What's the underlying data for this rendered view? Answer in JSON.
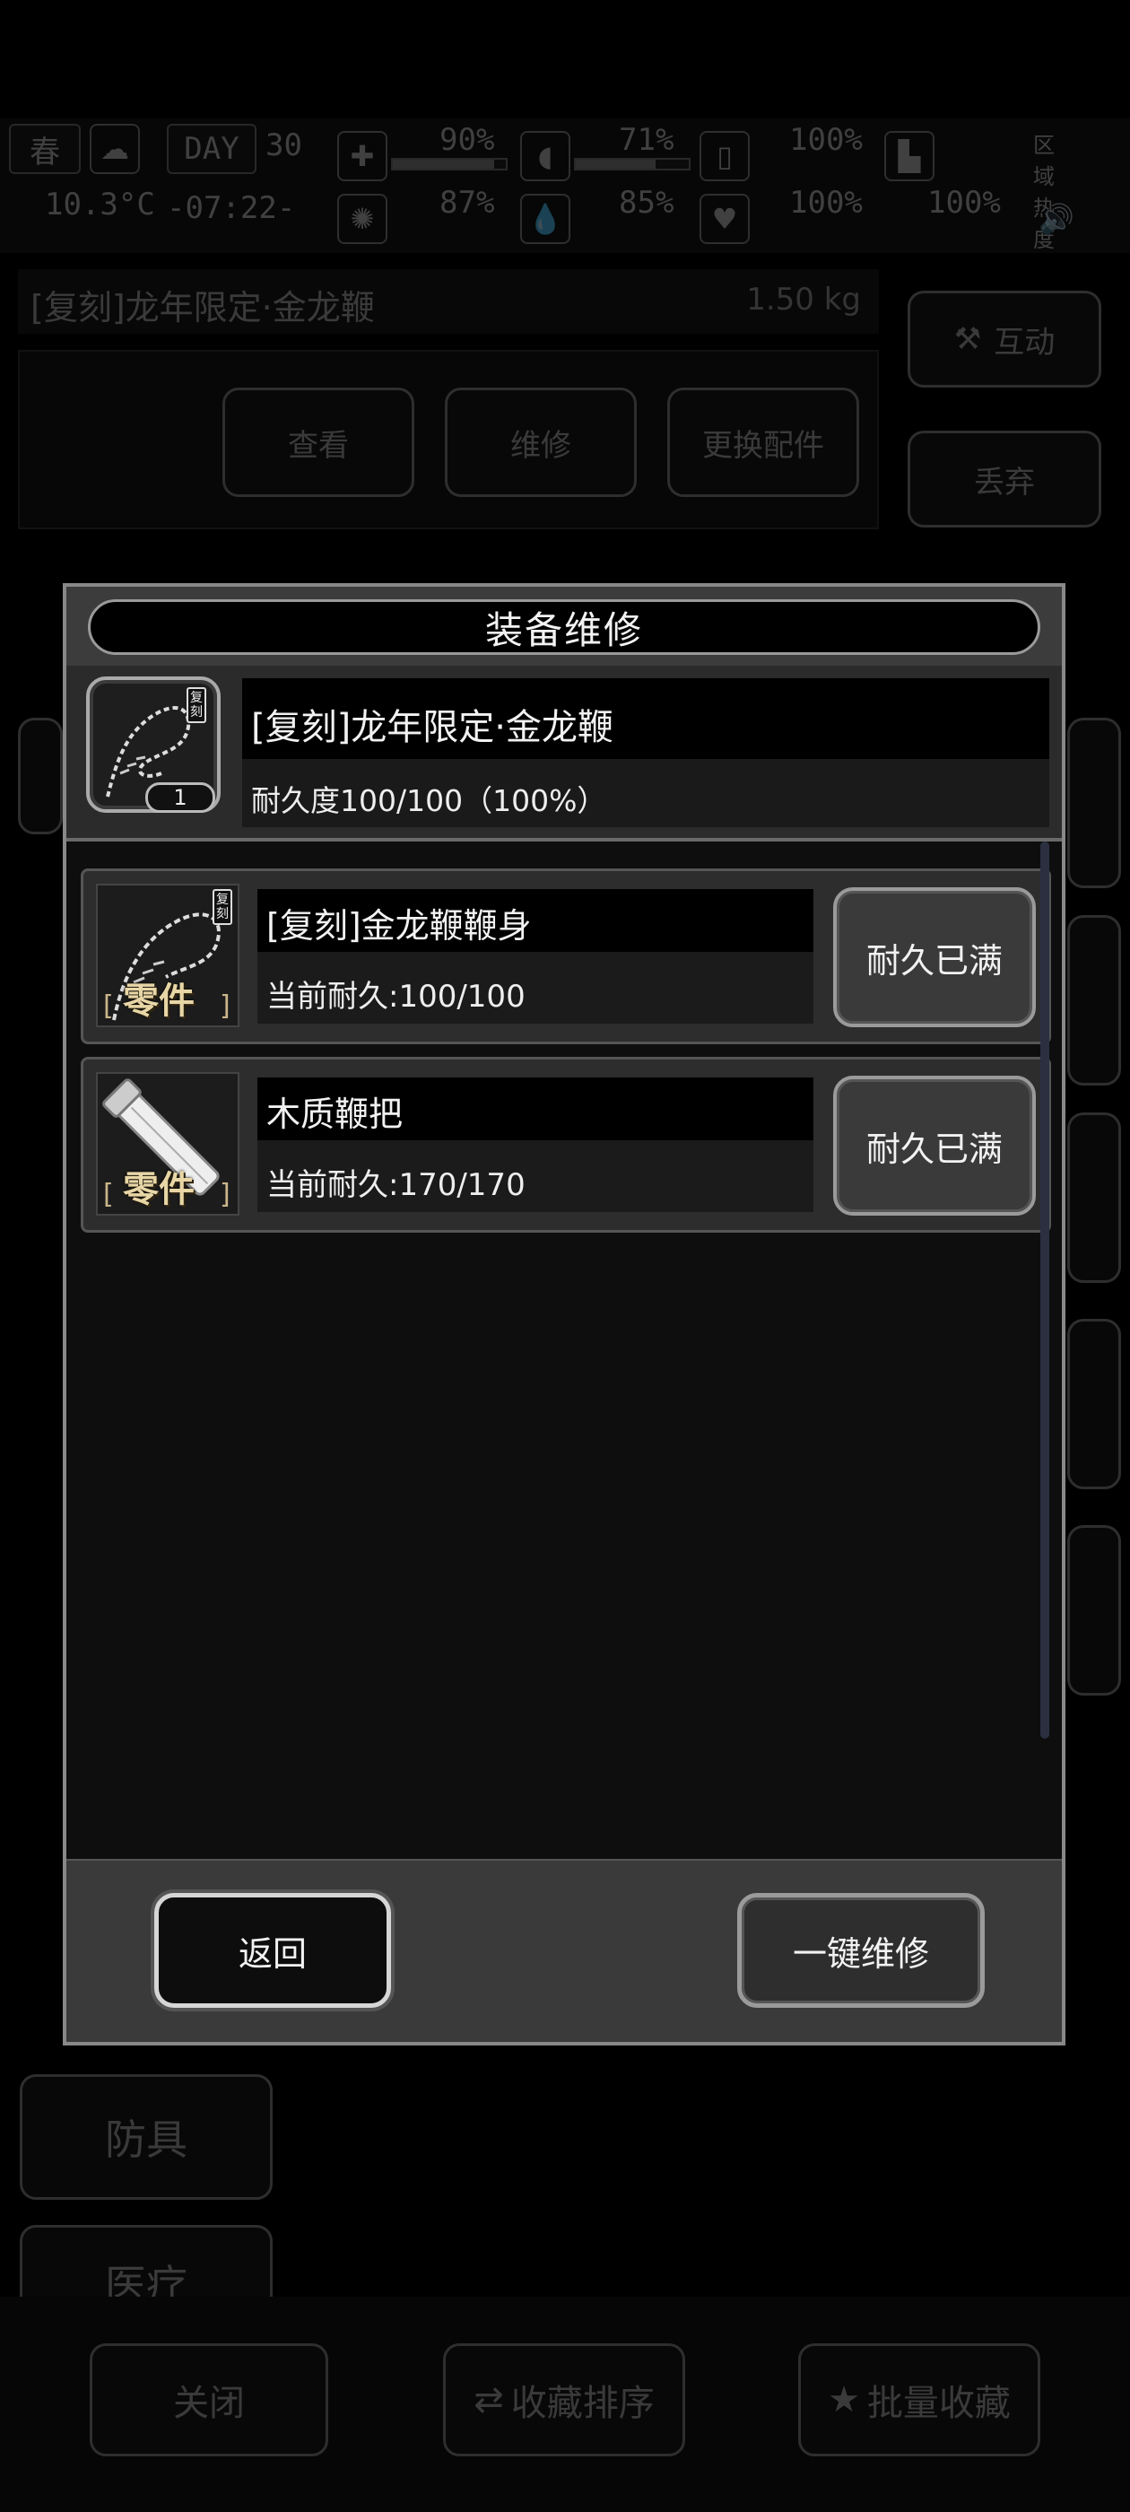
{
  "hud": {
    "season": "春",
    "day_label": "DAY",
    "day": "30",
    "temperature": "10.3°C",
    "time": "-07:22-",
    "health_pct": "90%",
    "stomach_pct": "71%",
    "sanity_pct": "87%",
    "water_pct": "85%",
    "stat3_pct": "100%",
    "stat4_pct": "100%",
    "stat5_pct": "100%",
    "zone_label": "区域热度",
    "bars": {
      "health": 0.9,
      "stomach": 0.71,
      "sanity": 0.87,
      "water": 0.85
    }
  },
  "background": {
    "item_name": "[复刻]龙年限定·金龙鞭",
    "item_weight": "1.50 kg",
    "view_label": "查看",
    "repair_label": "维修",
    "swap_label": "更换配件",
    "interact_label": "互动",
    "discard_label": "丢弃",
    "armor_label": "防具",
    "medical_label": "医疗",
    "close_label": "关闭",
    "sort_label": "收藏排序",
    "batch_fav_label": "批量收藏"
  },
  "modal": {
    "title": "装备维修",
    "item": {
      "name": "[复刻]龙年限定·金龙鞭",
      "durability": "耐久度100/100（100%）",
      "quantity": "1",
      "tag": "复刻"
    },
    "part_tag": "零件",
    "parts": [
      {
        "name": "[复刻]金龙鞭鞭身",
        "durability": "当前耐久:100/100",
        "button": "耐久已满",
        "tag": "复刻"
      },
      {
        "name": "木质鞭把",
        "durability": "当前耐久:170/170",
        "button": "耐久已满"
      }
    ],
    "back_label": "返回",
    "repair_all_label": "一键维修"
  }
}
